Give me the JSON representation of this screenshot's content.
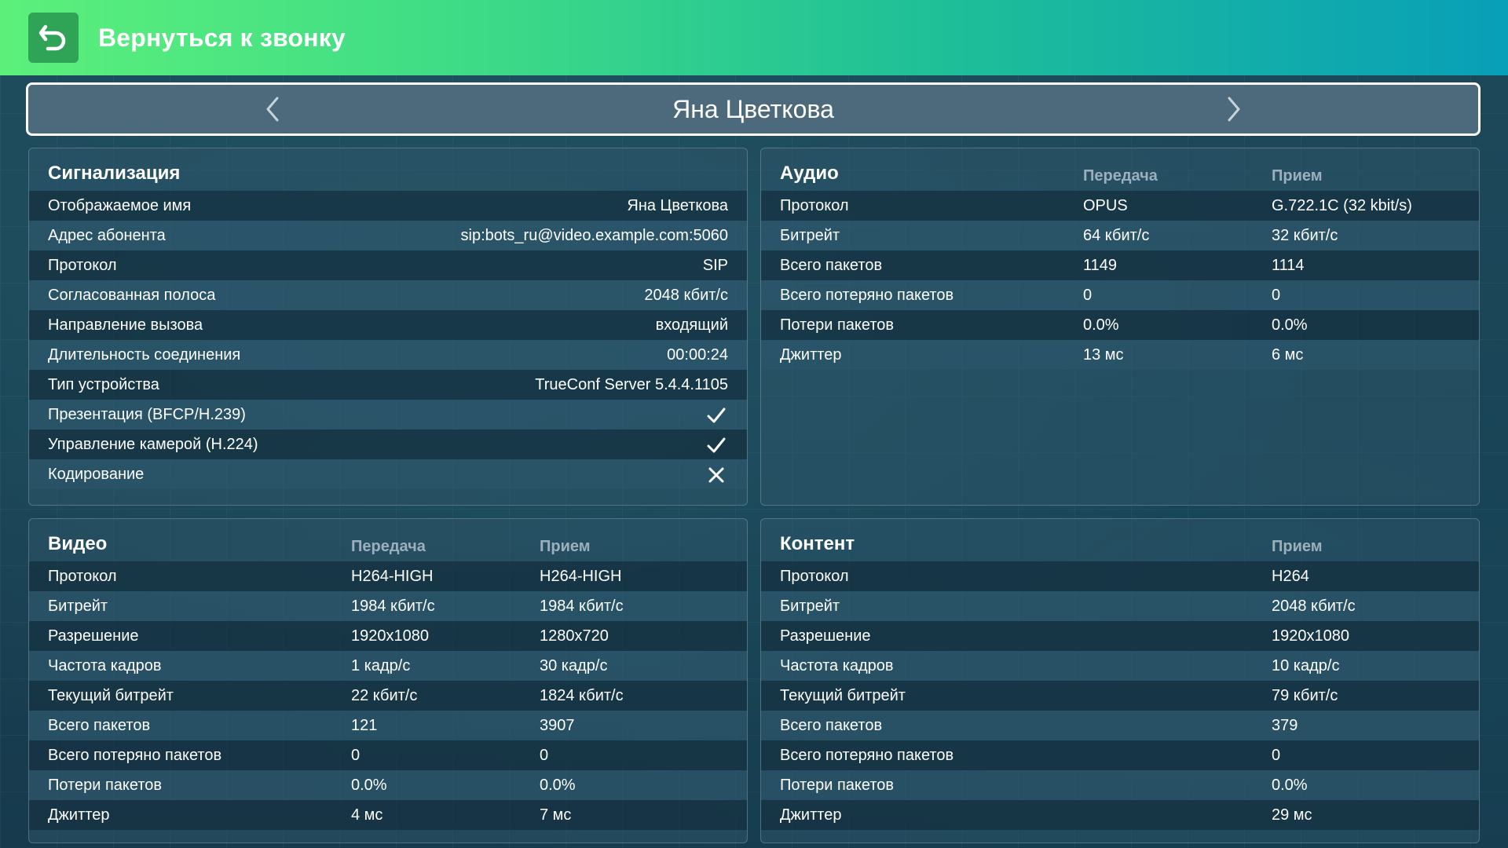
{
  "header": {
    "back_label": "Вернуться к звонку",
    "accent": "#2fa356"
  },
  "switcher": {
    "participant_name": "Яна Цветкова"
  },
  "signaling": {
    "title": "Сигнализация",
    "rows": [
      {
        "label": "Отображаемое имя",
        "value": "Яна Цветкова"
      },
      {
        "label": "Адрес абонента",
        "value": "sip:bots_ru@video.example.com:5060"
      },
      {
        "label": "Протокол",
        "value": "SIP"
      },
      {
        "label": "Согласованная полоса",
        "value": "2048 кбит/с"
      },
      {
        "label": "Направление вызова",
        "value": "входящий"
      },
      {
        "label": "Длительность соединения",
        "value": "00:00:24"
      },
      {
        "label": "Тип устройства",
        "value": "TrueConf Server 5.4.4.1105"
      },
      {
        "label": "Презентация (BFCP/H.239)",
        "icon": "check-icon"
      },
      {
        "label": "Управление камерой (H.224)",
        "icon": "check-icon"
      },
      {
        "label": "Кодирование",
        "icon": "cross-icon"
      }
    ]
  },
  "audio": {
    "title": "Аудио",
    "col_tx": "Передача",
    "col_rx": "Прием",
    "rows": [
      {
        "label": "Протокол",
        "tx": "OPUS",
        "rx": "G.722.1C (32 kbit/s)"
      },
      {
        "label": "Битрейт",
        "tx": "64 кбит/с",
        "rx": "32 кбит/с"
      },
      {
        "label": "Всего пакетов",
        "tx": "1149",
        "rx": "1114"
      },
      {
        "label": "Всего потеряно пакетов",
        "tx": "0",
        "rx": "0"
      },
      {
        "label": "Потери пакетов",
        "tx": "0.0%",
        "rx": "0.0%"
      },
      {
        "label": "Джиттер",
        "tx": "13 мс",
        "rx": "6 мс"
      }
    ]
  },
  "video": {
    "title": "Видео",
    "col_tx": "Передача",
    "col_rx": "Прием",
    "rows": [
      {
        "label": "Протокол",
        "tx": "H264-HIGH",
        "rx": "H264-HIGH"
      },
      {
        "label": "Битрейт",
        "tx": "1984 кбит/с",
        "rx": "1984 кбит/с"
      },
      {
        "label": "Разрешение",
        "tx": "1920x1080",
        "rx": "1280x720"
      },
      {
        "label": "Частота кадров",
        "tx": "1 кадр/с",
        "rx": "30 кадр/с"
      },
      {
        "label": "Текущий битрейт",
        "tx": "22 кбит/с",
        "rx": "1824 кбит/с"
      },
      {
        "label": "Всего пакетов",
        "tx": "121",
        "rx": "3907"
      },
      {
        "label": "Всего потеряно пакетов",
        "tx": "0",
        "rx": "0"
      },
      {
        "label": "Потери пакетов",
        "tx": "0.0%",
        "rx": "0.0%"
      },
      {
        "label": "Джиттер",
        "tx": "4 мс",
        "rx": "7 мс"
      }
    ]
  },
  "content": {
    "title": "Контент",
    "col_rx": "Прием",
    "rows": [
      {
        "label": "Протокол",
        "rx": "H264"
      },
      {
        "label": "Битрейт",
        "rx": "2048 кбит/с"
      },
      {
        "label": "Разрешение",
        "rx": "1920x1080"
      },
      {
        "label": "Частота кадров",
        "rx": "10 кадр/с"
      },
      {
        "label": "Текущий битрейт",
        "rx": "79 кбит/с"
      },
      {
        "label": "Всего пакетов",
        "rx": "379"
      },
      {
        "label": "Всего потеряно пакетов",
        "rx": "0"
      },
      {
        "label": "Потери пакетов",
        "rx": "0.0%"
      },
      {
        "label": "Джиттер",
        "rx": "29 мс"
      }
    ]
  }
}
